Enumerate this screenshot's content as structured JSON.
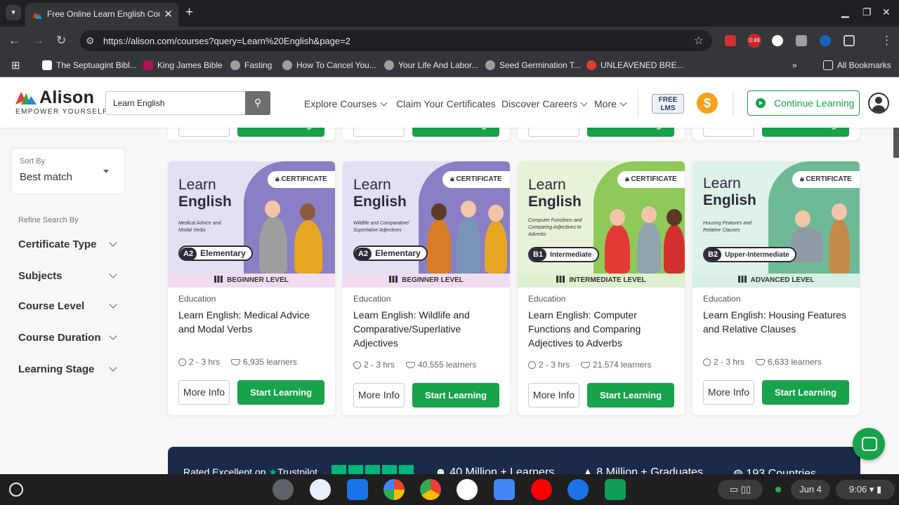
{
  "browser": {
    "tab_title": "Free Online Learn English Cou",
    "url": "https://alison.com/courses?query=Learn%20English&page=2",
    "badge": "0:49",
    "bookmarks": [
      "The Septuagint Bibl...",
      "King James Bible",
      "Fasting",
      "How To Cancel You...",
      "Your Life And Labor...",
      "Seed Germination T...",
      "UNLEAVENED BRE..."
    ],
    "all_bookmarks": "All Bookmarks"
  },
  "header": {
    "logo": "Alison",
    "tagline": "EMPOWER YOURSELF",
    "search_value": "Learn English",
    "nav": [
      "Explore Courses",
      "Claim Your Certificates",
      "Discover Careers",
      "More"
    ],
    "free_lms_1": "FREE",
    "free_lms_2": "LMS",
    "coin": "$",
    "continue": "Continue Learning"
  },
  "sidebar": {
    "sort_label": "Sort By",
    "sort_value": "Best match",
    "refine_label": "Refine Search By",
    "filters": [
      "Certificate Type",
      "Subjects",
      "Course Level",
      "Course Duration",
      "Learning Stage"
    ]
  },
  "top_row": {
    "more": "More Info",
    "start": "Start Learning"
  },
  "courses": [
    {
      "banner_title_1": "Learn",
      "banner_title_2": "English",
      "banner_sub": "Medical Advice and Modal Verbs",
      "level_code": "A2",
      "level_name": "Elementary",
      "cert": "CERTIFICATE",
      "level": "BEGINNER LEVEL",
      "category": "Education",
      "title": "Learn English: Medical Advice and Modal Verbs",
      "duration": "2 - 3 hrs",
      "learners": "6,935 learners",
      "more": "More Info",
      "start": "Start Learning"
    },
    {
      "banner_title_1": "Learn",
      "banner_title_2": "English",
      "banner_sub": "Wildlife and Comparative/ Superlative Adjectives",
      "level_code": "A2",
      "level_name": "Elementary",
      "cert": "CERTIFICATE",
      "level": "BEGINNER LEVEL",
      "category": "Education",
      "title": "Learn English: Wildlife and Comparative/Superlative Adjectives",
      "duration": "2 - 3 hrs",
      "learners": "40,555 learners",
      "more": "More Info",
      "start": "Start Learning"
    },
    {
      "banner_title_1": "Learn",
      "banner_title_2": "English",
      "banner_sub": "Computer Functions and Comparing Adjectives to Adverbs",
      "level_code": "B1",
      "level_name": "Intermediate",
      "cert": "CERTIFICATE",
      "level": "INTERMEDIATE LEVEL",
      "category": "Education",
      "title": "Learn English: Computer Functions and Comparing Adjectives to Adverbs",
      "duration": "2 - 3 hrs",
      "learners": "21,574 learners",
      "more": "More Info",
      "start": "Start Learning"
    },
    {
      "banner_title_1": "Learn",
      "banner_title_2": "English",
      "banner_sub": "Housing Features and Relative Clauses",
      "level_code": "B2",
      "level_name": "Upper-Intermediate",
      "cert": "CERTIFICATE",
      "level": "ADVANCED LEVEL",
      "category": "Education",
      "title": "Learn English: Housing Features and Relative Clauses",
      "duration": "2 - 3 hrs",
      "learners": "6,633 learners",
      "more": "More Info",
      "start": "Start Learning"
    }
  ],
  "stats": {
    "rated": "Rated Excellent on",
    "trustpilot": "Trustpilot",
    "learners": "40 Million + Learners",
    "graduates": "8 Million + Graduates",
    "countries": "193 Countries"
  },
  "shelf": {
    "date": "Jun 4",
    "time": "9:06"
  },
  "colors": {
    "primary_green": "#16a34a",
    "beginner_banner": "#e4e0f4",
    "intermediate_banner": "#e6f3d8",
    "advanced_banner": "#dff2ea",
    "stats_navy": "#1b2a4a"
  }
}
